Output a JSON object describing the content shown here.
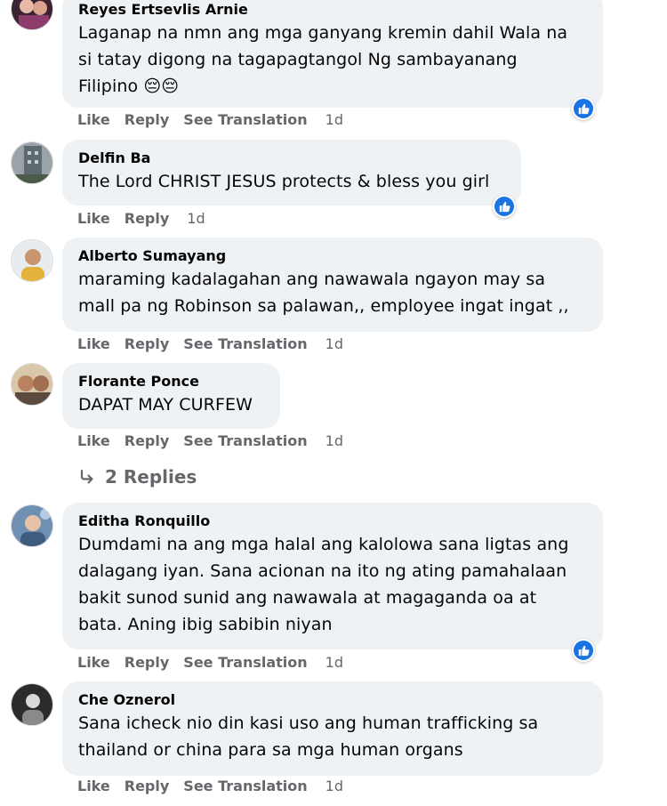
{
  "actions": {
    "like": "Like",
    "reply": "Reply",
    "see_translation": "See Translation"
  },
  "colors": {
    "bubble": "#eff2f5",
    "action_text": "#65676b",
    "like_blue": "#1b74e4"
  },
  "comments": [
    {
      "author": "Reyes Ertsevlis Arnie",
      "lines": [
        "Laganap na nmn ang mga ganyang kremin dahil Wala na",
        "si tatay digong na tagapagtangol Ng sambayanang",
        "Filipino 😔😔"
      ],
      "timestamp": "1d",
      "has_translation": true,
      "reaction_icon": "like-icon"
    },
    {
      "author": "Delfin Ba",
      "lines": [
        "The Lord CHRIST JESUS protects & bless you girl"
      ],
      "timestamp": "1d",
      "has_translation": false,
      "reaction_icon": "like-icon"
    },
    {
      "author": "Alberto Sumayang",
      "lines": [
        "maraming kadalagahan ang nawawala ngayon may sa",
        "mall pa ng Robinson sa palawan,, employee ingat ingat ,,"
      ],
      "timestamp": "1d",
      "has_translation": true
    },
    {
      "author": "Florante Ponce",
      "lines": [
        "DAPAT MAY CURFEW"
      ],
      "timestamp": "1d",
      "has_translation": true,
      "replies_label": "2 Replies"
    },
    {
      "author": "Editha Ronquillo",
      "lines": [
        "Dumdami na ang mga halal ang kalolowa sana ligtas ang",
        "dalagang iyan. Sana acionan na ito ng ating pamahalaan",
        "bakit sunod sunid ang nawawala at magaganda oa at",
        "bata. Aning ibig sabibin niyan"
      ],
      "timestamp": "1d",
      "has_translation": true,
      "reaction_icon": "like-icon"
    },
    {
      "author": "Che Oznerol",
      "lines": [
        "Sana icheck nio din kasi uso ang human trafficking sa",
        "thailand or china para sa mga human organs"
      ],
      "timestamp": "1d",
      "has_translation": true
    }
  ]
}
